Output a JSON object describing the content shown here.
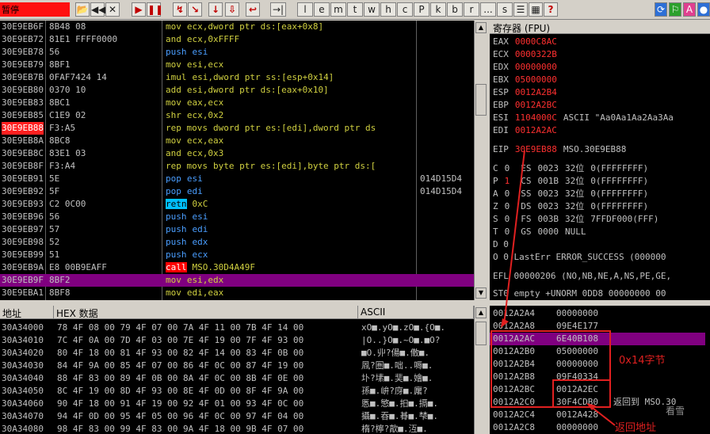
{
  "toolbar": {
    "status": "暂停",
    "buttons": [
      "📂",
      "◀◀",
      "✕",
      "▶",
      "❚❚",
      "↯",
      "↘",
      "↓",
      "⇩",
      "↩",
      "→|"
    ],
    "letters": [
      "l",
      "e",
      "m",
      "t",
      "w",
      "h",
      "c",
      "P",
      "k",
      "b",
      "r",
      "...",
      "s"
    ],
    "right_buttons": [
      "☰",
      "▦",
      "?"
    ],
    "app_buttons": [
      "⟳",
      "⚐",
      "A",
      "●"
    ],
    "colors": {
      "status_bg": "#ff1010"
    }
  },
  "disasm": {
    "rows": [
      {
        "addr": "30E9EB6F",
        "hex": "8B48 08",
        "op": "mov",
        "args": "ecx,dword ptr ds:[eax+0x8]",
        "comment": ""
      },
      {
        "addr": "30E9EB72",
        "hex": "81E1 FFFF0000",
        "op": "and",
        "args": "ecx,0xFFFF",
        "comment": ""
      },
      {
        "addr": "30E9EB78",
        "hex": "56",
        "op": "push",
        "args": "esi",
        "comment": ""
      },
      {
        "addr": "30E9EB79",
        "hex": "8BF1",
        "op": "mov",
        "args": "esi,ecx",
        "comment": ""
      },
      {
        "addr": "30E9EB7B",
        "hex": "0FAF7424 14",
        "op": "imul",
        "args": "esi,dword ptr ss:[esp+0x14]",
        "comment": ""
      },
      {
        "addr": "30E9EB80",
        "hex": "0370 10",
        "op": "add",
        "args": "esi,dword ptr ds:[eax+0x10]",
        "comment": ""
      },
      {
        "addr": "30E9EB83",
        "hex": "8BC1",
        "op": "mov",
        "args": "eax,ecx",
        "comment": ""
      },
      {
        "addr": "30E9EB85",
        "hex": "C1E9 02",
        "op": "shr",
        "args": "ecx,0x2",
        "comment": ""
      },
      {
        "addr": "30E9EB88",
        "hex": "F3:A5",
        "op": "rep movs",
        "args": "dword ptr es:[edi],dword ptr ds",
        "comment": ""
      },
      {
        "addr": "30E9EB8A",
        "hex": "8BC8",
        "op": "mov",
        "args": "ecx,eax",
        "comment": ""
      },
      {
        "addr": "30E9EB8C",
        "hex": "83E1 03",
        "op": "and",
        "args": "ecx,0x3",
        "comment": ""
      },
      {
        "addr": "30E9EB8F",
        "hex": "F3:A4",
        "op": "rep movs",
        "args": "byte ptr es:[edi],byte ptr ds:[",
        "comment": ""
      },
      {
        "addr": "30E9EB91",
        "hex": "5E",
        "op": "pop",
        "args": "esi",
        "comment": "014D15D4"
      },
      {
        "addr": "30E9EB92",
        "hex": "5F",
        "op": "pop",
        "args": "edi",
        "comment": "014D15D4"
      },
      {
        "addr": "30E9EB93",
        "hex": "C2 0C00",
        "op": "retn",
        "args": "0xC",
        "comment": ""
      },
      {
        "addr": "30E9EB96",
        "hex": "56",
        "op": "push",
        "args": "esi",
        "comment": ""
      },
      {
        "addr": "30E9EB97",
        "hex": "57",
        "op": "push",
        "args": "edi",
        "comment": ""
      },
      {
        "addr": "30E9EB98",
        "hex": "52",
        "op": "push",
        "args": "edx",
        "comment": ""
      },
      {
        "addr": "30E9EB99",
        "hex": "51",
        "op": "push",
        "args": "ecx",
        "comment": ""
      },
      {
        "addr": "30E9EB9A",
        "hex": "E8 00B9EAFF",
        "op": "call",
        "args": "MSO.30D4A49F",
        "comment": ""
      },
      {
        "addr": "30E9EB9F",
        "hex": "8BF2",
        "op": "mov",
        "args": "esi,edx",
        "comment": ""
      },
      {
        "addr": "30E9EBA1",
        "hex": "8BF8",
        "op": "mov",
        "args": "edi,eax",
        "comment": ""
      }
    ]
  },
  "registers": {
    "title": "寄存器 (FPU)",
    "gp": [
      {
        "name": "EAX",
        "value": "0000C8AC",
        "note": ""
      },
      {
        "name": "ECX",
        "value": "0000322B",
        "note": ""
      },
      {
        "name": "EDX",
        "value": "00000000",
        "note": ""
      },
      {
        "name": "EBX",
        "value": "05000000",
        "note": ""
      },
      {
        "name": "ESP",
        "value": "0012A2B4",
        "note": ""
      },
      {
        "name": "EBP",
        "value": "0012A2BC",
        "note": ""
      },
      {
        "name": "ESI",
        "value": "1104000C",
        "note": "ASCII \"Aa0Aa1Aa2Aa3Aa"
      },
      {
        "name": "EDI",
        "value": "0012A2AC",
        "note": ""
      }
    ],
    "eip": {
      "name": "EIP",
      "value": "30E9EB88",
      "note": "MSO.30E9EB88"
    },
    "flags": [
      {
        "f": "C",
        "v": "0",
        "seg": "ES",
        "sel": "0023",
        "bits": "32位",
        "base": "0(FFFFFFFF)"
      },
      {
        "f": "P",
        "v": "1",
        "seg": "CS",
        "sel": "001B",
        "bits": "32位",
        "base": "0(FFFFFFFF)"
      },
      {
        "f": "A",
        "v": "0",
        "seg": "SS",
        "sel": "0023",
        "bits": "32位",
        "base": "0(FFFFFFFF)"
      },
      {
        "f": "Z",
        "v": "0",
        "seg": "DS",
        "sel": "0023",
        "bits": "32位",
        "base": "0(FFFFFFFF)"
      },
      {
        "f": "S",
        "v": "0",
        "seg": "FS",
        "sel": "003B",
        "bits": "32位",
        "base": "7FFDF000(FFF)"
      },
      {
        "f": "T",
        "v": "0",
        "seg": "GS",
        "sel": "0000",
        "bits": "NULL",
        "base": ""
      }
    ],
    "d_flag": "D 0",
    "o_line": "O 0  LastErr ERROR_SUCCESS (000000",
    "efl": "EFL 00000206 (NO,NB,NE,A,NS,PE,GE,",
    "st0": "ST0 empty +UNORM 0DD8 00000000 00"
  },
  "dump": {
    "headers": {
      "addr": "地址",
      "hex": "HEX 数据",
      "ascii": "ASCII"
    },
    "rows": [
      {
        "addr": "30A34000",
        "hex": "78 4F 08 00 79 4F 07 00 7A 4F 11 00 7B 4F 14 00",
        "ascii": "xO■.yO■.zO■.{O■."
      },
      {
        "addr": "30A34010",
        "hex": "7C 4F 0A 00 7D 4F 03 00 7E 4F 19 00 7F 4F 93 00",
        "ascii": "|O..}O■.~O■.■O?"
      },
      {
        "addr": "30A34020",
        "hex": "80 4F 18 00 81 4F 93 00 82 4F 14 00 83 4F 0B 00",
        "ascii": "■O.丱?偒■.僌■."
      },
      {
        "addr": "30A34030",
        "hex": "84 4F 9A 00 85 4F 07 00 86 4F 0C 00 87 4F 19 00",
        "ascii": "凮?圏■.咄..嗕■."
      },
      {
        "addr": "30A34040",
        "hex": "88 4F 83 00 89 4F 0B 00 8A 4F 0C 00 8B 4F 0E 00",
        "ascii": "圤?塐■.奜■.嬒■."
      },
      {
        "addr": "30A34050",
        "hex": "8C 4F 19 00 8D 4F 93 00 8E 4F 0D 00 8F 4F 9A 00",
        "ascii": "孫■.峅?庌■.廜?"
      },
      {
        "addr": "30A34060",
        "hex": "90 4F 18 00 91 4F 19 00 92 4F 01 00 93 4F 0C 00",
        "ascii": "悘■.慜■.抇■.搹■."
      },
      {
        "addr": "30A34070",
        "hex": "94 4F 0D 00 95 4F 05 00 96 4F 0C 00 97 4F 04 00",
        "ascii": "攝■.昋■.朞■.梺■."
      },
      {
        "addr": "30A34080",
        "hex": "98 4F 83 00 99 4F 83 00 9A 4F 18 00 9B 4F 07 00",
        "ascii": "楕?檸?歊■.沍■."
      }
    ]
  },
  "stack": {
    "rows": [
      {
        "addr": "0012A2A4",
        "value": "00000000",
        "note": ""
      },
      {
        "addr": "0012A2A8",
        "value": "09E4E177",
        "note": ""
      },
      {
        "addr": "0012A2AC",
        "value": "6E40B108",
        "note": ""
      },
      {
        "addr": "0012A2B0",
        "value": "05000000",
        "note": ""
      },
      {
        "addr": "0012A2B4",
        "value": "00000000",
        "note": ""
      },
      {
        "addr": "0012A2B8",
        "value": "09F40334",
        "note": ""
      },
      {
        "addr": "0012A2BC",
        "value": "0012A2EC",
        "note": ""
      },
      {
        "addr": "0012A2C0",
        "value": "30F4CDB0",
        "note": "返回到 MSO.30"
      },
      {
        "addr": "0012A2C4",
        "value": "0012A428",
        "note": ""
      },
      {
        "addr": "0012A2C8",
        "value": "00000000",
        "note": ""
      }
    ]
  },
  "annotations": {
    "box_label": "0x14字节",
    "return_label": "返回地址",
    "watermark": "看雪"
  }
}
